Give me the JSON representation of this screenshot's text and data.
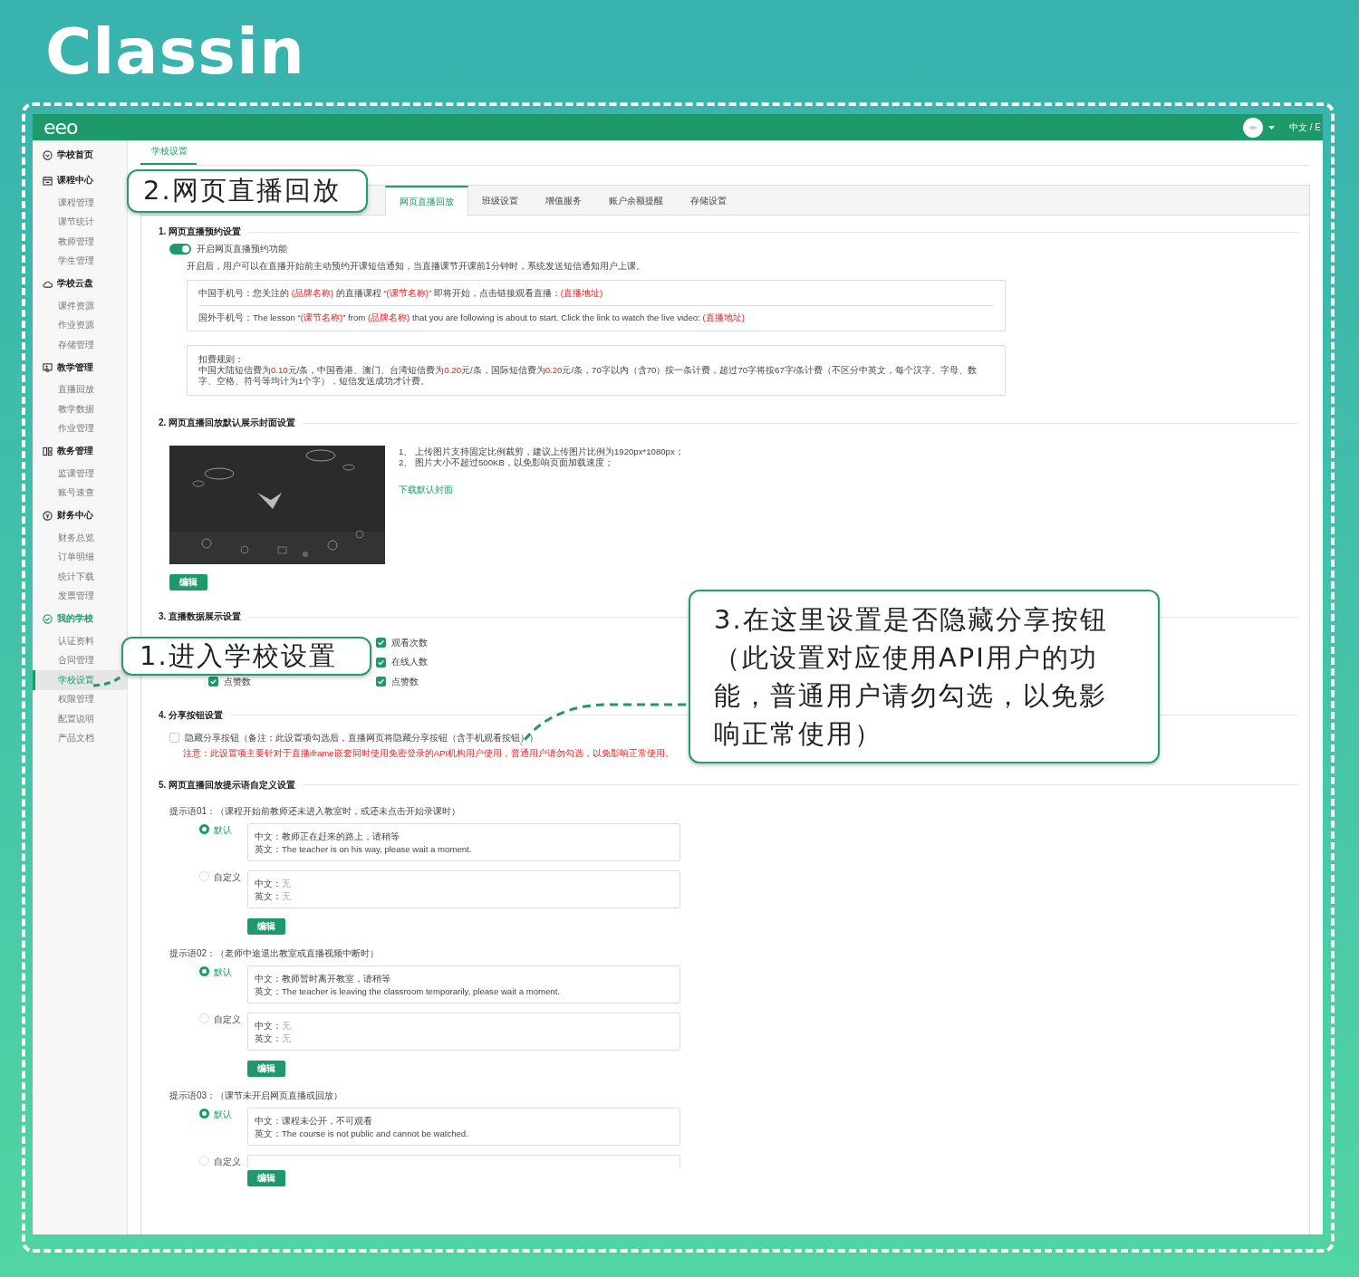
{
  "brand": "Classin",
  "topbar": {
    "logo": "eeo",
    "language": "中文 / E"
  },
  "sidebar": {
    "groups": [
      {
        "label": "学校首页",
        "selected": false
      },
      {
        "label": "课程中心",
        "selected": false,
        "children": [
          {
            "label": "课程管理",
            "selected": false
          },
          {
            "label": "课节统计",
            "selected": false
          },
          {
            "label": "教师管理",
            "selected": false
          },
          {
            "label": "学生管理",
            "selected": false
          }
        ]
      },
      {
        "label": "学校云盘",
        "selected": false,
        "children": [
          {
            "label": "课件资源",
            "selected": false
          },
          {
            "label": "作业资源",
            "selected": false
          },
          {
            "label": "存储管理",
            "selected": false
          }
        ]
      },
      {
        "label": "教学管理",
        "selected": false,
        "children": [
          {
            "label": "直播回放",
            "selected": false
          },
          {
            "label": "教学数据",
            "selected": false
          },
          {
            "label": "作业管理",
            "selected": false
          }
        ]
      },
      {
        "label": "教务管理",
        "selected": false,
        "children": [
          {
            "label": "监课管理",
            "selected": false
          },
          {
            "label": "账号速查",
            "selected": false
          }
        ]
      },
      {
        "label": "财务中心",
        "selected": false,
        "children": [
          {
            "label": "财务总览",
            "selected": false
          },
          {
            "label": "订单明细",
            "selected": false
          },
          {
            "label": "统计下载",
            "selected": false
          },
          {
            "label": "发票管理",
            "selected": false
          }
        ]
      },
      {
        "label": "我的学校",
        "selected": true,
        "children": [
          {
            "label": "认证资料",
            "selected": false
          },
          {
            "label": "合同管理",
            "selected": false
          },
          {
            "label": "学校设置",
            "selected": true
          },
          {
            "label": "权限管理",
            "selected": false
          },
          {
            "label": "配置说明",
            "selected": false
          },
          {
            "label": "产品文档",
            "selected": false
          }
        ]
      }
    ]
  },
  "breadcrumb": {
    "label": "学校设置",
    "selected": true
  },
  "tabs": [
    {
      "label": "网页直播回放",
      "selected": true
    },
    {
      "label": "班级设置",
      "selected": false
    },
    {
      "label": "增值服务",
      "selected": false
    },
    {
      "label": "账户余额提醒",
      "selected": false
    },
    {
      "label": "存储设置",
      "selected": false
    }
  ],
  "booking": {
    "title": "1. 网页直播预约设置",
    "toggle": {
      "label": "开启网页直播预约功能",
      "on": true
    },
    "description": "开启后，用户可以在直播开始前主动预约开课短信通知，当直播课节开课前1分钟时，系统发送短信通知用户上课。",
    "templates": [
      [
        {
          "text": "中国手机号：您关注的 ",
          "highlight": false
        },
        {
          "text": "(品牌名称)",
          "highlight": true
        },
        {
          "text": " 的直播课程 ",
          "highlight": false
        },
        {
          "text": "“(课节名称)”",
          "highlight": true
        },
        {
          "text": " 即将开始，点击链接观看直播：",
          "highlight": false
        },
        {
          "text": "(直播地址)",
          "highlight": true
        }
      ],
      [
        {
          "text": "国外手机号：The lesson “",
          "highlight": false
        },
        {
          "text": "(课节名称)",
          "highlight": true
        },
        {
          "text": "” from ",
          "highlight": false
        },
        {
          "text": "(品牌名称)",
          "highlight": true
        },
        {
          "text": " that you are following is about to start. Click the link to watch the live video: ",
          "highlight": false
        },
        {
          "text": "(直播地址)",
          "highlight": true
        }
      ]
    ],
    "fee_title": "扣费规则：",
    "fee": [
      {
        "text": "中国大陆短信费为",
        "highlight": false
      },
      {
        "text": "0.10",
        "highlight": true
      },
      {
        "text": "元/条，中国香港、澳门、台湾短信费为",
        "highlight": false
      },
      {
        "text": "0.20",
        "highlight": true
      },
      {
        "text": "元/条，国际短信费为",
        "highlight": false
      },
      {
        "text": "0.20",
        "highlight": true
      },
      {
        "text": "元/条，70字以内（含70）按一条计费，超过70字将按67字/条计费（不区分中英文，每个汉字、字母、数字、空格、符号等均计为1个字），短信发送成功才计费。",
        "highlight": false
      }
    ]
  },
  "cover": {
    "title": "2. 网页直播回放默认展示封面设置",
    "notes": [
      "1、 上传图片支持固定比例裁剪，建议上传图片比例为1920px*1080px；",
      "2、 图片大小不超过500KB，以免影响页面加载速度；"
    ],
    "link": "下载默认封面",
    "button": "编辑"
  },
  "live_data": {
    "title": "3. 直播数据展示设置",
    "left": [
      {
        "label": "点赞数",
        "checked": true
      }
    ],
    "right": [
      {
        "label": "观看次数",
        "checked": true
      },
      {
        "label": "在线人数",
        "checked": true
      },
      {
        "label": "点赞数",
        "checked": true
      }
    ]
  },
  "share": {
    "title": "4. 分享按钮设置",
    "checkbox": {
      "label": "隐藏分享按钮（备注：此设置项勾选后，直播网页将隐藏分享按钮（含手机观看按钮））",
      "checked": false
    },
    "warning": "注意：此设置项主要针对于直播iframe嵌套同时使用免密登录的API机构用户使用，普通用户请勿勾选，以免影响正常使用。"
  },
  "prompts": {
    "title": "5. 网页直播回放提示语自定义设置",
    "items": [
      {
        "label": "提示语01：",
        "condition": "（课程开始前教师还未进入教室时，或还未点击开始录课时）",
        "options": [
          {
            "label": "默认",
            "selected": true,
            "lines": [
              {
                "key": "中文：",
                "value": "教师正在赶来的路上，请稍等",
                "muted": false
              },
              {
                "key": "英文：",
                "value": "The teacher is on his way, please wait a moment.",
                "muted": false
              }
            ]
          },
          {
            "label": "自定义",
            "selected": false,
            "lines": [
              {
                "key": "中文：",
                "value": "无",
                "muted": true
              },
              {
                "key": "英文：",
                "value": "无",
                "muted": true
              }
            ]
          }
        ],
        "button": "编辑"
      },
      {
        "label": "提示语02：",
        "condition": "（老师中途退出教室或直播视频中断时）",
        "options": [
          {
            "label": "默认",
            "selected": true,
            "lines": [
              {
                "key": "中文：",
                "value": "教师暂时离开教室，请稍等",
                "muted": false
              },
              {
                "key": "英文：",
                "value": "The teacher is leaving the classroom temporarily, please wait a moment.",
                "muted": false
              }
            ]
          },
          {
            "label": "自定义",
            "selected": false,
            "lines": [
              {
                "key": "中文：",
                "value": "无",
                "muted": true
              },
              {
                "key": "英文：",
                "value": "无",
                "muted": true
              }
            ]
          }
        ],
        "button": "编辑"
      },
      {
        "label": "提示语03：",
        "condition": "（课节未开启网页直播或回放）",
        "options": [
          {
            "label": "默认",
            "selected": true,
            "lines": [
              {
                "key": "中文：",
                "value": "课程未公开，不可观看",
                "muted": false
              },
              {
                "key": "英文：",
                "value": "The course is not public and cannot be watched.",
                "muted": false
              }
            ]
          },
          {
            "label": "自定义",
            "selected": false
          }
        ],
        "button": "编辑"
      }
    ]
  },
  "callouts": [
    {
      "text": "2.网页直播回放"
    },
    {
      "text": "1.进入学校设置"
    },
    {
      "text": "3.在这里设置是否隐藏分享按钮（此设置对应使用API用户的功能，普通用户请勿勾选，以免影响正常使用）"
    }
  ]
}
